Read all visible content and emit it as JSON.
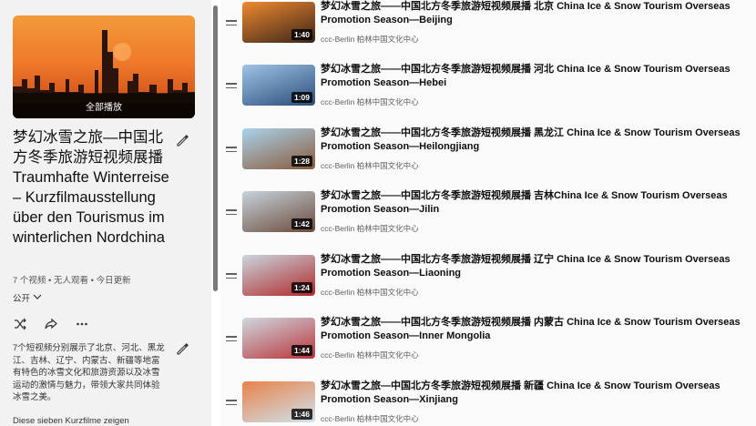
{
  "playlist": {
    "play_all_label": "全部播放",
    "title": "梦幻冰雪之旅—中国北方冬季旅游短视频展播 Traumhafte Winterreise – Kurzfilmausstellung über den Tourismus im winterlichen Nordchina",
    "meta": "7 个视频 • 无人观看 • 今日更新",
    "privacy": "公开",
    "description": "7个短视频分别展示了北京、河北、黑龙江、吉林、辽宁、内蒙古、新疆等地富有特色的冰雪文化和旅游资源以及冰雪运动的激情与魅力，带领大家共同体验冰雪之美。",
    "description_de": "Diese sieben Kurzfilme zeigen"
  },
  "colors": {
    "panel_bg": "#f2f2f2",
    "list_bg": "#fafafa",
    "scroll_thumb": "#7a7a7a"
  },
  "videos": [
    {
      "title": "梦幻冰雪之旅——中国北方冬季旅游短视频展播 北京 China Ice & Snow Tourism Overseas Promotion Season—Beijing",
      "channel": "ccc-Berlin 柏林中国文化中心",
      "duration": "1:40",
      "thumb_colors": [
        "#f08a30",
        "#3a2418"
      ]
    },
    {
      "title": "梦幻冰雪之旅——中国北方冬季旅游短视频展播 河北 China Ice & Snow Tourism Overseas Promotion Season—Hebei",
      "channel": "ccc-Berlin 柏林中国文化中心",
      "duration": "1:09",
      "thumb_colors": [
        "#9fc4e6",
        "#2a4d7a"
      ]
    },
    {
      "title": "梦幻冰雪之旅——中国北方冬季旅游短视频展播 黑龙江 China Ice & Snow Tourism Overseas Promotion Season—Heilongjiang",
      "channel": "ccc-Berlin 柏林中国文化中心",
      "duration": "1:28",
      "thumb_colors": [
        "#a9d3ec",
        "#8a5a3a"
      ]
    },
    {
      "title": "梦幻冰雪之旅——中国北方冬季旅游短视频展播 吉林China Ice & Snow Tourism Overseas Promotion Season—Jilin",
      "channel": "ccc-Berlin 柏林中国文化中心",
      "duration": "1:42",
      "thumb_colors": [
        "#c6d3dc",
        "#6b4a3a"
      ]
    },
    {
      "title": "梦幻冰雪之旅——中国北方冬季旅游短视频展播 辽宁 China Ice & Snow Tourism Overseas Promotion Season—Liaoning",
      "channel": "ccc-Berlin 柏林中国文化中心",
      "duration": "1:24",
      "thumb_colors": [
        "#c9d6df",
        "#b02a2a"
      ]
    },
    {
      "title": "梦幻冰雪之旅——中国北方冬季旅游短视频展播 内蒙古 China Ice & Snow Tourism Overseas Promotion Season—Inner Mongolia",
      "channel": "ccc-Berlin 柏林中国文化中心",
      "duration": "1:44",
      "thumb_colors": [
        "#cfd9e0",
        "#b8343a"
      ]
    },
    {
      "title": "梦幻冰雪之旅—中国北方冬季旅游短视频展播 新疆 China Ice & Snow Tourism Overseas Promotion Season—Xinjiang",
      "channel": "ccc-Berlin 柏林中国文化中心",
      "duration": "1:46",
      "thumb_colors": [
        "#e8824a",
        "#cfe2ee"
      ]
    }
  ]
}
